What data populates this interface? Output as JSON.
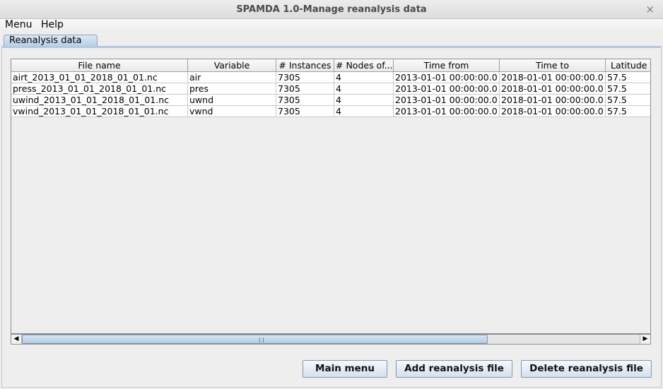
{
  "window": {
    "title": "SPAMDA 1.0-Manage reanalysis data",
    "close_glyph": "×"
  },
  "menubar": {
    "items": [
      "Menu",
      "Help"
    ]
  },
  "tab": {
    "label": "Reanalysis data"
  },
  "table": {
    "columns": [
      "File name",
      "Variable",
      "# Instances",
      "# Nodes of...",
      "Time from",
      "Time to",
      "Latitude f"
    ],
    "rows": [
      [
        "airt_2013_01_01_2018_01_01.nc",
        "air",
        "7305",
        "4",
        "2013-01-01 00:00:00.0",
        "2018-01-01 00:00:00.0",
        "57.5"
      ],
      [
        "press_2013_01_01_2018_01_01.nc",
        "pres",
        "7305",
        "4",
        "2013-01-01 00:00:00.0",
        "2018-01-01 00:00:00.0",
        "57.5"
      ],
      [
        "uwind_2013_01_01_2018_01_01.nc",
        "uwnd",
        "7305",
        "4",
        "2013-01-01 00:00:00.0",
        "2018-01-01 00:00:00.0",
        "57.5"
      ],
      [
        "vwind_2013_01_01_2018_01_01.nc",
        "vwnd",
        "7305",
        "4",
        "2013-01-01 00:00:00.0",
        "2018-01-01 00:00:00.0",
        "57.5"
      ]
    ]
  },
  "scrollbar": {
    "left_arrow": "◀",
    "right_arrow": "▶"
  },
  "buttons": {
    "main_menu": "Main menu",
    "add_file": "Add reanalysis file",
    "delete_file": "Delete reanalysis file"
  },
  "colors": {
    "tab_accent": "#b7cde4",
    "button_border": "#7f96b3"
  }
}
